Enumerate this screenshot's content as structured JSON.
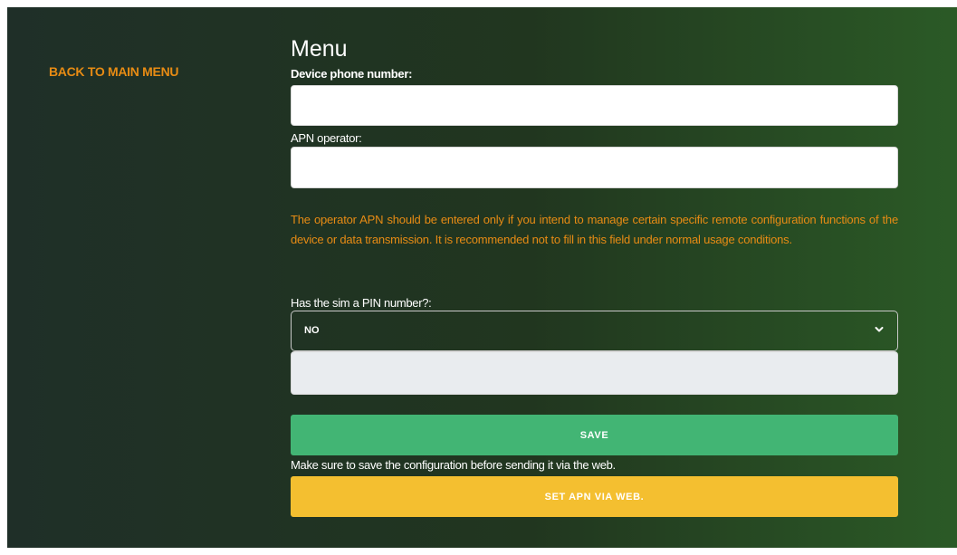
{
  "nav": {
    "back_label": "BACK TO MAIN MENU"
  },
  "page": {
    "title": "Menu"
  },
  "form": {
    "phone_label": "Device phone number:",
    "phone_value": "",
    "apn_label": "APN operator:",
    "apn_value": "",
    "apn_hint": "The operator APN should be entered only if you intend to manage certain specific remote configuration functions of the device or data transmission. It is recommended not to fill in this field under normal usage conditions.",
    "pin_label": "Has the sim a PIN number?:",
    "pin_selected": "NO",
    "pin_value": ""
  },
  "actions": {
    "save_label": "SAVE",
    "save_note": "Make sure to save the configuration before sending it via the web.",
    "web_label": "SET APN VIA WEB."
  },
  "colors": {
    "accent_orange": "#e78b14",
    "save_green": "#42b574",
    "web_yellow": "#f4bf30"
  },
  "icons": {
    "dropdown": "chevron-down-icon"
  }
}
